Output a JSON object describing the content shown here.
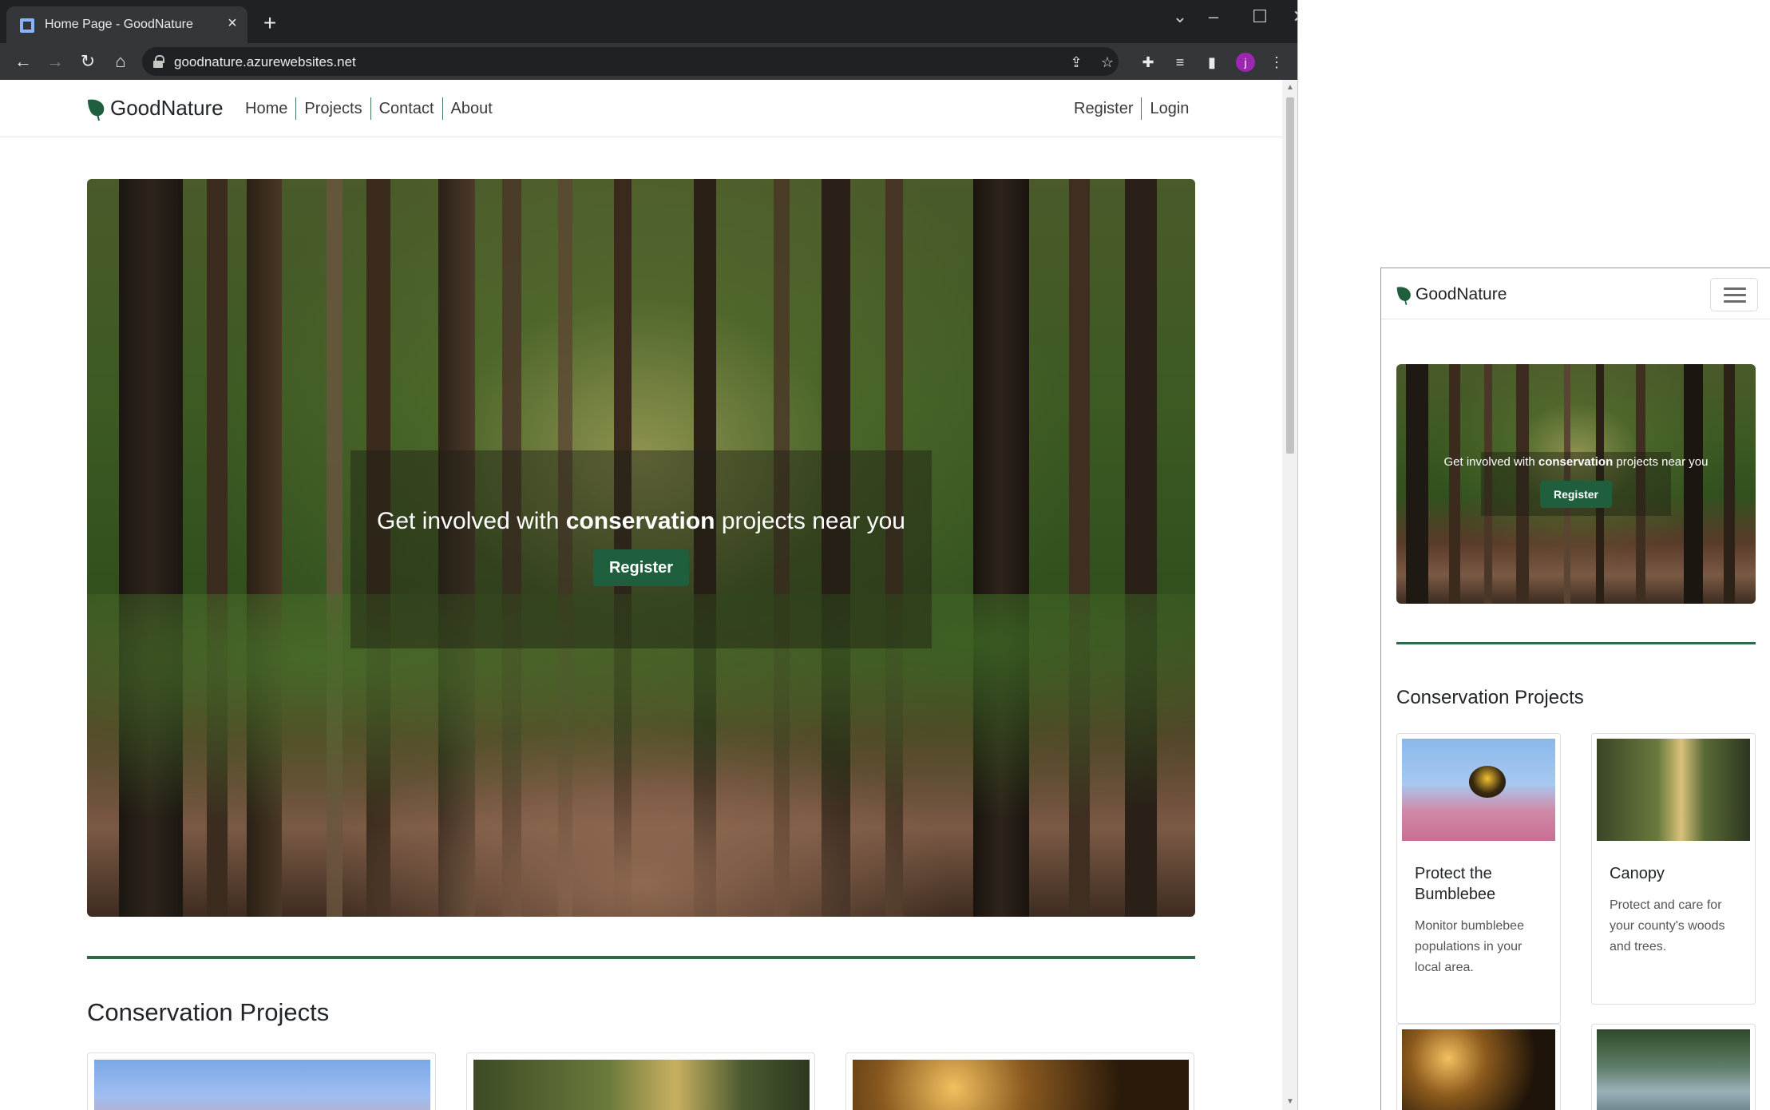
{
  "browser": {
    "tab_title": "Home Page - GoodNature",
    "url": "goodnature.azurewebsites.net",
    "avatar_letter": "j",
    "icons": {
      "close_tab": "×",
      "new_tab": "+",
      "tab_search": "⌄",
      "minimize": "–",
      "maximize": "☐",
      "close_window": "✕",
      "back": "←",
      "forward": "→",
      "reload": "↻",
      "home": "⌂",
      "share": "⇪",
      "bookmark": "☆",
      "extensions": "✚",
      "media": "≡",
      "sidepanel": "▮",
      "menu": "⋮"
    }
  },
  "site": {
    "brand": "GoodNature",
    "nav": {
      "home": "Home",
      "projects": "Projects",
      "contact": "Contact",
      "about": "About",
      "register": "Register",
      "login": "Login"
    },
    "hero": {
      "headline_before": "Get involved with ",
      "headline_bold": "conservation",
      "headline_after": " projects near you",
      "cta": "Register"
    },
    "projects_title": "Conservation Projects",
    "cards": [
      {
        "title": "Protect the Bumblebee",
        "text": "Monitor bumblebee populations in your local area."
      },
      {
        "title": "Canopy",
        "text": "Protect and care for your county's woods and trees."
      }
    ]
  },
  "colors": {
    "brand_green": "#1f5f3e",
    "divider_green": "#2a6b45",
    "chrome_dark": "#202124",
    "chrome_toolbar": "#35363a"
  }
}
